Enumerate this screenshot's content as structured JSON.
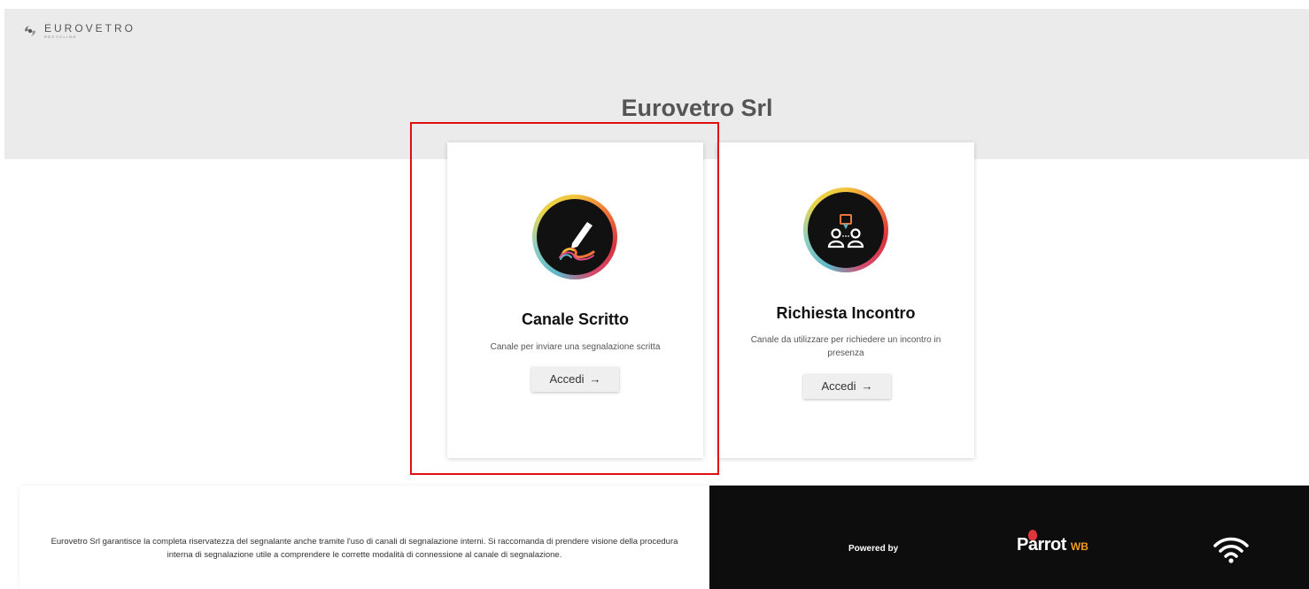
{
  "brand": {
    "name": "EUROVETRO",
    "subtitle": "RECYCLING"
  },
  "page": {
    "title": "Eurovetro Srl"
  },
  "cards": [
    {
      "title": "Canale Scritto",
      "description": "Canale per inviare una segnalazione scritta",
      "button_label": "Accedi",
      "button_arrow": "→",
      "icon": "pen-icon"
    },
    {
      "title": "Richiesta Incontro",
      "description": "Canale da utilizzare per richiedere un incontro in presenza",
      "button_label": "Accedi",
      "button_arrow": "→",
      "icon": "meeting-icon"
    }
  ],
  "footer": {
    "notice": "Eurovetro Srl garantisce la completa riservatezza del segnalante anche tramite l'uso di canali di segnalazione interni. Si raccomanda di prendere visione della procedura interna di segnalazione utile a comprendere le corrette modalità di connessione al canale di segnalazione.",
    "powered_by": "Powered by",
    "partner_name": "Parrot",
    "partner_badge": "WB"
  },
  "colors": {
    "highlight": "#e01010",
    "header_bg": "#ebebeb",
    "footer_dark": "#0d0d0d",
    "accent_orange": "#f39a1e"
  }
}
